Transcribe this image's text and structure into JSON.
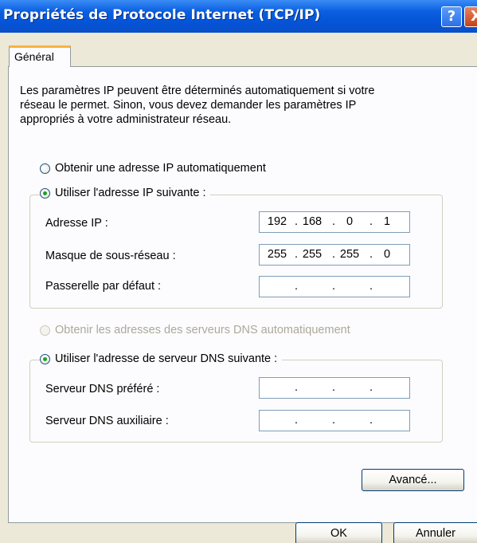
{
  "window": {
    "title": "Propriétés de Protocole Internet (TCP/IP)",
    "help_glyph": "?",
    "close_glyph": "X",
    "title_gradient": [
      "#3b8cf5",
      "#0553d6"
    ]
  },
  "tabs": [
    {
      "label": "Général",
      "selected": true
    }
  ],
  "intro": {
    "lines": [
      "Les paramètres IP peuvent être déterminés automatiquement si votre",
      "réseau le permet. Sinon, vous devez demander les paramètres IP",
      "appropriés à votre administrateur réseau."
    ]
  },
  "ip_section": {
    "auto_option": {
      "label": "Obtenir une adresse IP automatiquement",
      "checked": false
    },
    "manual_option": {
      "label": "Utiliser l'adresse IP suivante :",
      "checked": true
    },
    "fields": [
      {
        "label": "Adresse IP :",
        "octets": [
          "192",
          "168",
          "0",
          "1"
        ]
      },
      {
        "label": "Masque de sous-réseau :",
        "octets": [
          "255",
          "255",
          "255",
          "0"
        ]
      },
      {
        "label": "Passerelle par défaut :",
        "octets": [
          "",
          "",
          "",
          ""
        ]
      }
    ]
  },
  "dns_section": {
    "auto_option": {
      "label": "Obtenir les adresses des serveurs DNS automatiquement",
      "checked": false,
      "disabled": true
    },
    "manual_option": {
      "label": "Utiliser l'adresse de serveur DNS suivante :",
      "checked": true
    },
    "fields": [
      {
        "label": "Serveur DNS préféré :",
        "octets": [
          "",
          "",
          "",
          ""
        ]
      },
      {
        "label": "Serveur DNS auxiliaire :",
        "octets": [
          "",
          "",
          "",
          ""
        ]
      }
    ]
  },
  "buttons": {
    "advanced": "Avancé...",
    "ok": "OK",
    "cancel": "Annuler"
  },
  "colors": {
    "face": "#ece9d8",
    "panel": "#fcfcfe",
    "tab_accent": "#f9b33c",
    "radio_dot": "#21a121",
    "input_border": "#7f9db9",
    "button_border": "#003c74",
    "disabled_text": "#aca899"
  },
  "ip_dot_glyph": "."
}
